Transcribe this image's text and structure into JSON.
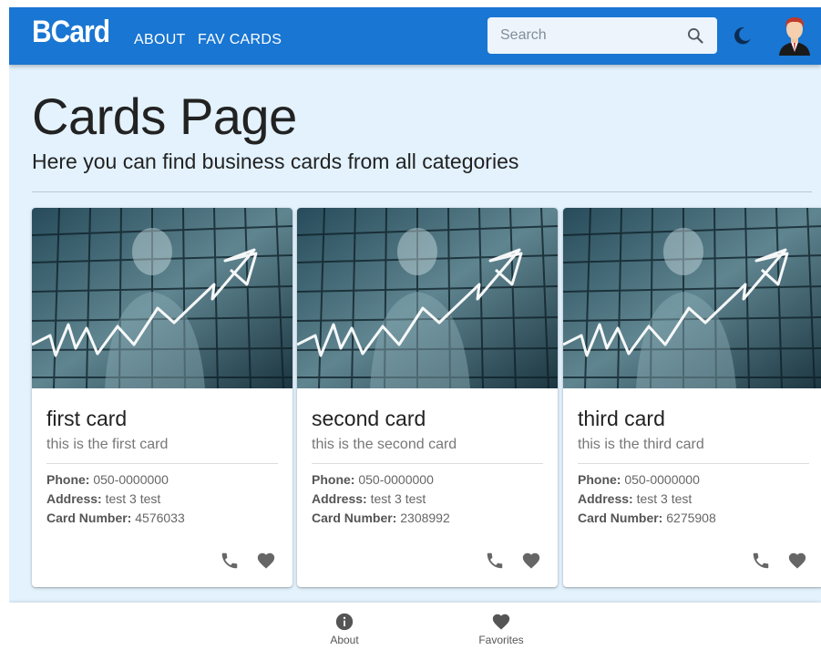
{
  "header": {
    "brand": "BCard",
    "nav": [
      "ABOUT",
      "FAV CARDS"
    ],
    "search_placeholder": "Search",
    "icons": {
      "search": "search-icon",
      "theme": "moon-icon",
      "avatar": "avatar-icon"
    },
    "color": "#1976d2"
  },
  "page": {
    "title": "Cards Page",
    "subtitle": "Here you can find business cards from all categories"
  },
  "cards": [
    {
      "title": "first card",
      "subtitle": "this is the first card",
      "phone_label": "Phone:",
      "phone": "050-0000000",
      "address_label": "Address:",
      "address": "test 3 test",
      "number_label": "Card Number:",
      "number": "4576033"
    },
    {
      "title": "second card",
      "subtitle": "this is the second card",
      "phone_label": "Phone:",
      "phone": "050-0000000",
      "address_label": "Address:",
      "address": "test 3 test",
      "number_label": "Card Number:",
      "number": "2308992"
    },
    {
      "title": "third card",
      "subtitle": "this is the third card",
      "phone_label": "Phone:",
      "phone": "050-0000000",
      "address_label": "Address:",
      "address": "test 3 test",
      "number_label": "Card Number:",
      "number": "6275908"
    }
  ],
  "bottom_nav": [
    {
      "label": "About",
      "icon": "info-icon"
    },
    {
      "label": "Favorites",
      "icon": "heart-icon"
    }
  ]
}
